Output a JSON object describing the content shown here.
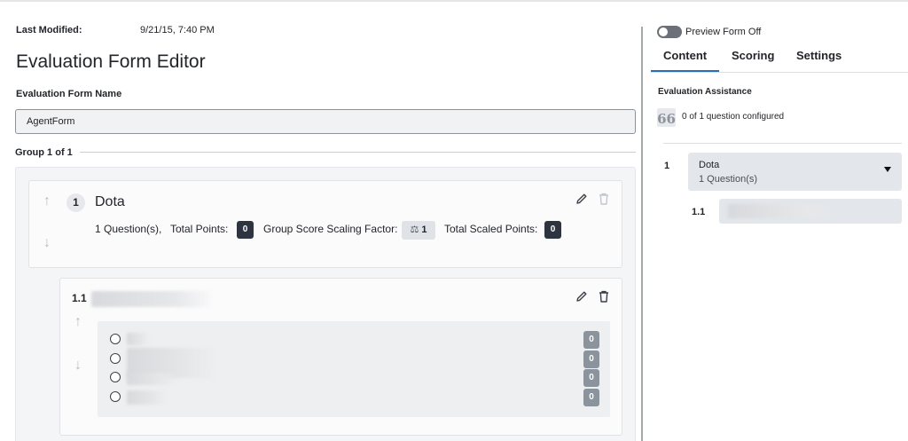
{
  "meta": {
    "last_modified_label": "Last Modified:",
    "last_modified_value": "9/21/15, 7:40 PM"
  },
  "page_title": "Evaluation Form Editor",
  "form_name": {
    "label": "Evaluation Form Name",
    "value": "AgentForm"
  },
  "group": {
    "header": "Group 1 of 1",
    "number": "1",
    "name": "Dota",
    "questions_count": "1 Question(s),",
    "total_points_label": "Total Points:",
    "total_points_value": "0",
    "scaling_label": "Group Score Scaling Factor:",
    "scaling_value": "1",
    "scaled_points_label": "Total Scaled Points:",
    "scaled_points_value": "0"
  },
  "question": {
    "number": "1.1",
    "answers": [
      {
        "points": "0"
      },
      {
        "points": "0"
      },
      {
        "points": "0"
      },
      {
        "points": "0"
      }
    ]
  },
  "preview": {
    "label": "Preview Form Off",
    "enabled": false
  },
  "tabs": [
    {
      "label": "Content",
      "active": true
    },
    {
      "label": "Scoring",
      "active": false
    },
    {
      "label": "Settings",
      "active": false
    }
  ],
  "assistance": {
    "title": "Evaluation Assistance",
    "icon": "66",
    "text": "0 of 1 question configured"
  },
  "outline": {
    "group_index": "1",
    "group_name": "Dota",
    "group_sub": "1 Question(s)",
    "question_index": "1.1"
  },
  "colors": {
    "accent": "#2a6fb5",
    "dark_badge": "#2e3440",
    "muted_badge": "#8b939d"
  }
}
